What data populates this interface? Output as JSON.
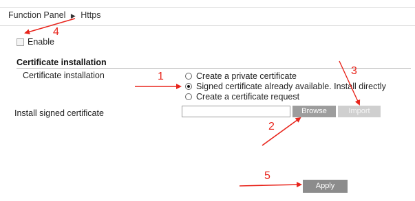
{
  "breadcrumb": {
    "items": [
      "Function Panel",
      "Https"
    ]
  },
  "enable": {
    "label": "Enable",
    "checked": false
  },
  "section": {
    "title": "Certificate installation"
  },
  "certificate": {
    "label": "Certificate installation",
    "options": [
      {
        "label": "Create a private certificate",
        "selected": false
      },
      {
        "label": "Signed certificate already available. Install directly",
        "selected": true
      },
      {
        "label": "Create a certificate request",
        "selected": false
      }
    ]
  },
  "install": {
    "label": "Install signed certificate",
    "value": "",
    "browse_label": "Browse",
    "import_label": "Import"
  },
  "apply_label": "Apply",
  "annotations": {
    "color": "#e8251c",
    "numbers": [
      "1",
      "2",
      "3",
      "4",
      "5"
    ]
  }
}
